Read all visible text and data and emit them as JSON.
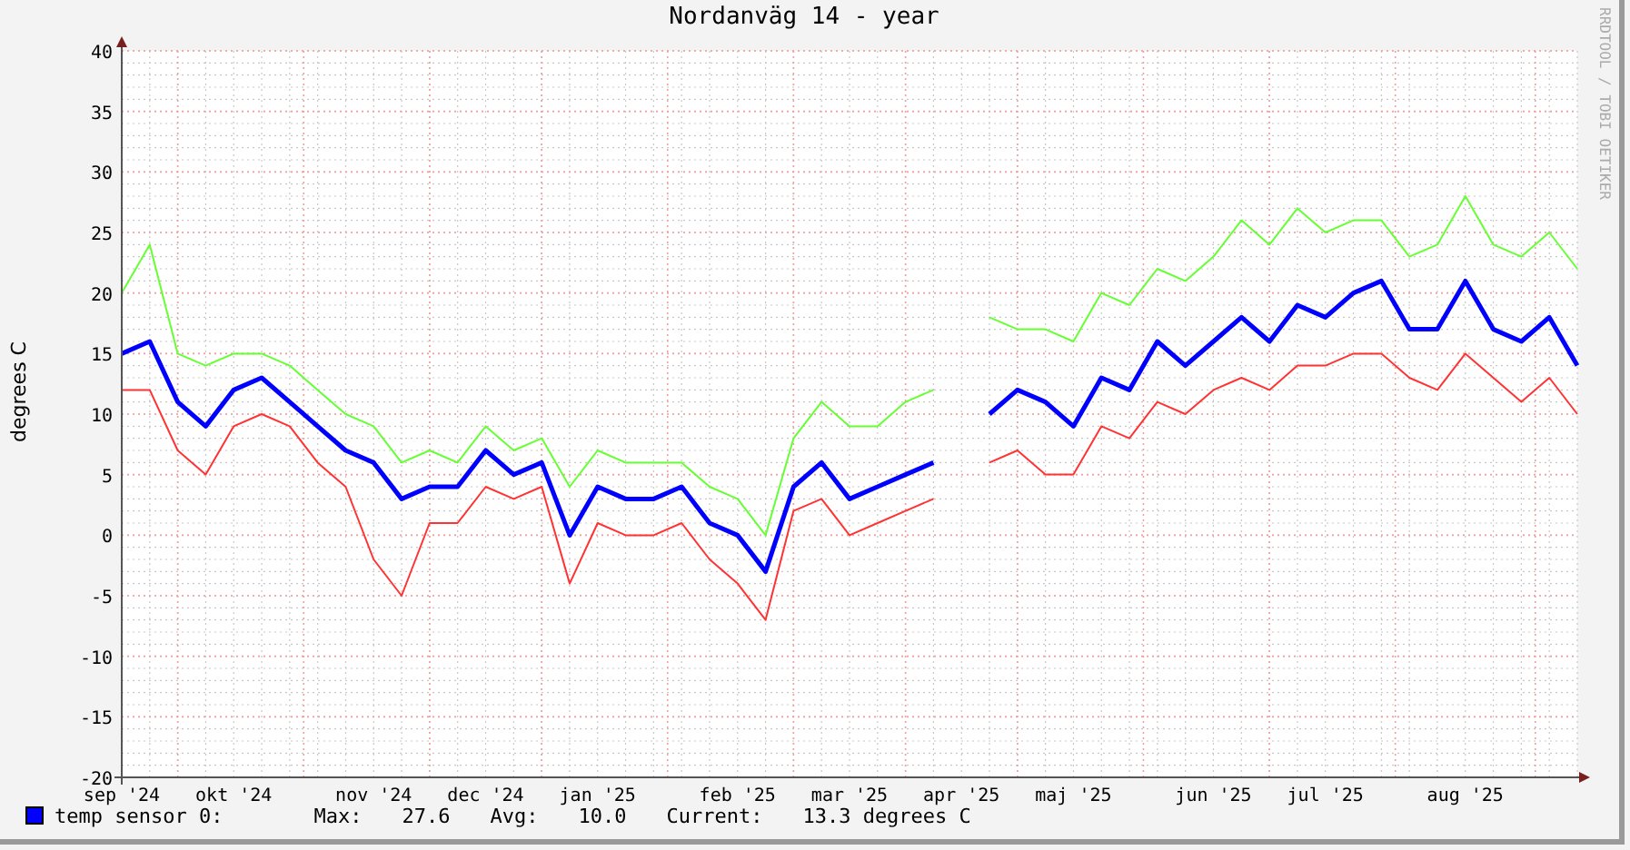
{
  "title": "Nordanväg 14 - year",
  "credit": "RRDTOOL / TOBI OETIKER",
  "chart_data": {
    "type": "line",
    "ylabel": "degrees C",
    "ylim": [
      -20,
      40
    ],
    "grid": true,
    "categories": [
      "sep '24",
      null,
      null,
      null,
      "okt '24",
      null,
      null,
      null,
      null,
      "nov '24",
      null,
      null,
      null,
      "dec '24",
      null,
      null,
      null,
      "jan '25",
      null,
      null,
      null,
      null,
      "feb '25",
      null,
      null,
      null,
      "mar '25",
      null,
      null,
      null,
      "apr '25",
      null,
      null,
      null,
      "maj '25",
      null,
      null,
      null,
      null,
      "jun '25",
      null,
      null,
      null,
      "jul '25",
      null,
      null,
      null,
      null,
      "aug '25",
      null,
      null,
      null,
      null
    ],
    "yticks": [
      -20,
      -15,
      -10,
      -5,
      0,
      5,
      10,
      15,
      20,
      25,
      30,
      35,
      40
    ],
    "series": [
      {
        "color": "#66ff33",
        "values": [
          20,
          24,
          15,
          14,
          15,
          15,
          14,
          12,
          10,
          9,
          6,
          7,
          6,
          9,
          7,
          8,
          4,
          7,
          6,
          6,
          6,
          4,
          3,
          0,
          8,
          11,
          9,
          9,
          11,
          12,
          null,
          18,
          17,
          17,
          16,
          20,
          19,
          22,
          21,
          23,
          26,
          24,
          27,
          25,
          26,
          26,
          23,
          24,
          28,
          24,
          23,
          25,
          22
        ]
      },
      {
        "color": "#ff3333",
        "values": [
          12,
          12,
          7,
          5,
          9,
          10,
          9,
          6,
          4,
          -2,
          -5,
          1,
          1,
          4,
          3,
          4,
          -4,
          1,
          0,
          0,
          1,
          -2,
          -4,
          -7,
          2,
          3,
          0,
          1,
          2,
          3,
          null,
          6,
          7,
          5,
          5,
          9,
          8,
          11,
          10,
          12,
          13,
          12,
          14,
          14,
          15,
          15,
          13,
          12,
          15,
          13,
          11,
          13,
          10
        ]
      },
      {
        "color": "#0000ff",
        "values": [
          15,
          16,
          11,
          9,
          12,
          13,
          11,
          9,
          7,
          6,
          3,
          4,
          4,
          7,
          5,
          6,
          0,
          4,
          3,
          3,
          4,
          1,
          0,
          -3,
          4,
          6,
          3,
          4,
          5,
          6,
          null,
          10,
          12,
          11,
          9,
          13,
          12,
          16,
          14,
          16,
          18,
          16,
          19,
          18,
          20,
          21,
          17,
          17,
          21,
          17,
          16,
          18,
          14
        ]
      }
    ]
  },
  "legend": {
    "label": "temp sensor 0:",
    "stats": [
      {
        "label": "Max:",
        "value": "27.6"
      },
      {
        "label": "Avg:",
        "value": "10.0"
      },
      {
        "label": "Current:",
        "value": "13.3 degrees C"
      }
    ]
  }
}
